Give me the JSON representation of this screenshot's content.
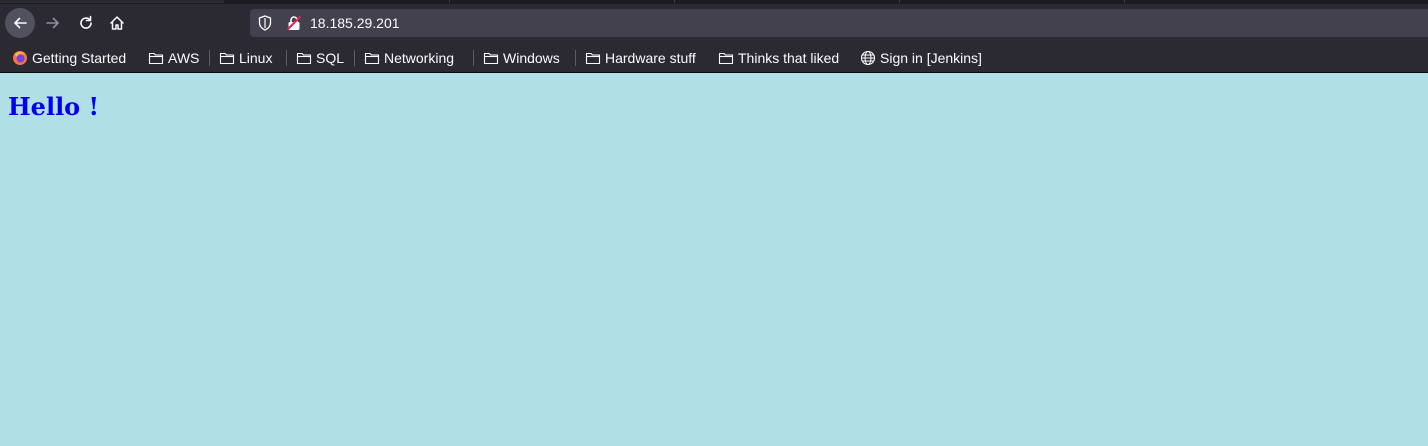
{
  "browser": {
    "url": "18.185.29.201",
    "bookmarks": [
      {
        "label": "Getting Started",
        "icon": "firefox-icon"
      },
      {
        "label": "AWS",
        "icon": "folder-icon"
      },
      {
        "label": "Linux",
        "icon": "folder-icon"
      },
      {
        "label": "SQL",
        "icon": "folder-icon"
      },
      {
        "label": "Networking",
        "icon": "folder-icon"
      },
      {
        "label": "Windows",
        "icon": "folder-icon"
      },
      {
        "label": "Hardware stuff",
        "icon": "folder-icon"
      },
      {
        "label": "Thinks that liked",
        "icon": "folder-icon"
      },
      {
        "label": "Sign in [Jenkins]",
        "icon": "globe-icon"
      }
    ],
    "colors": {
      "toolbar": "#2b2a33",
      "urlbar": "#42414d",
      "text": "#fbfbfe"
    }
  },
  "page": {
    "heading": "Hello !",
    "heading_color": "#0000ee",
    "background": "#b0dfe5"
  }
}
